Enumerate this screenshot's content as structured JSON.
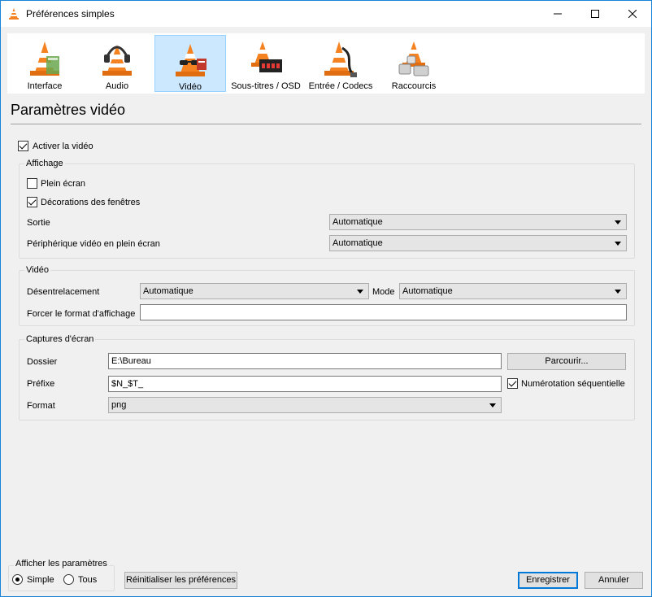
{
  "window": {
    "title": "Préférences simples"
  },
  "categories": [
    {
      "label": "Interface",
      "icon": "vlc-cone-interface-icon"
    },
    {
      "label": "Audio",
      "icon": "vlc-cone-headphones-icon"
    },
    {
      "label": "Vidéo",
      "icon": "vlc-cone-glasses-icon"
    },
    {
      "label": "Sous-titres / OSD",
      "icon": "vlc-cone-subtitles-icon"
    },
    {
      "label": "Entrée / Codecs",
      "icon": "vlc-cone-cable-icon"
    },
    {
      "label": "Raccourcis",
      "icon": "vlc-cone-hotkeys-icon"
    }
  ],
  "page": {
    "title": "Paramètres vidéo",
    "enable_video": {
      "label": "Activer la vidéo",
      "checked": true
    }
  },
  "affichage": {
    "title": "Affichage",
    "fullscreen": {
      "label": "Plein écran",
      "checked": false
    },
    "decorations": {
      "label": "Décorations des fenêtres",
      "checked": true
    },
    "sortie_label": "Sortie",
    "sortie_value": "Automatique",
    "device_label": "Périphérique vidéo en plein écran",
    "device_value": "Automatique"
  },
  "video": {
    "title": "Vidéo",
    "deinterlace_label": "Désentrelacement",
    "deinterlace_value": "Automatique",
    "mode_label": "Mode",
    "mode_value": "Automatique",
    "aspect_label": "Forcer le format d'affichage",
    "aspect_value": ""
  },
  "snapshots": {
    "title": "Captures d'écran",
    "folder_label": "Dossier",
    "folder_value": "E:\\Bureau",
    "browse_label": "Parcourir...",
    "prefix_label": "Préfixe",
    "prefix_value": "$N_$T_",
    "sequential": {
      "label": "Numérotation séquentielle",
      "checked": true
    },
    "format_label": "Format",
    "format_value": "png"
  },
  "footer": {
    "show_settings_title": "Afficher les paramètres",
    "simple_label": "Simple",
    "all_label": "Tous",
    "reset_label": "Réinitialiser les préférences",
    "save_label": "Enregistrer",
    "cancel_label": "Annuler"
  },
  "colors": {
    "accent": "#0078d7",
    "selected_tab_bg": "#cce8ff",
    "cone_orange": "#f58220"
  }
}
